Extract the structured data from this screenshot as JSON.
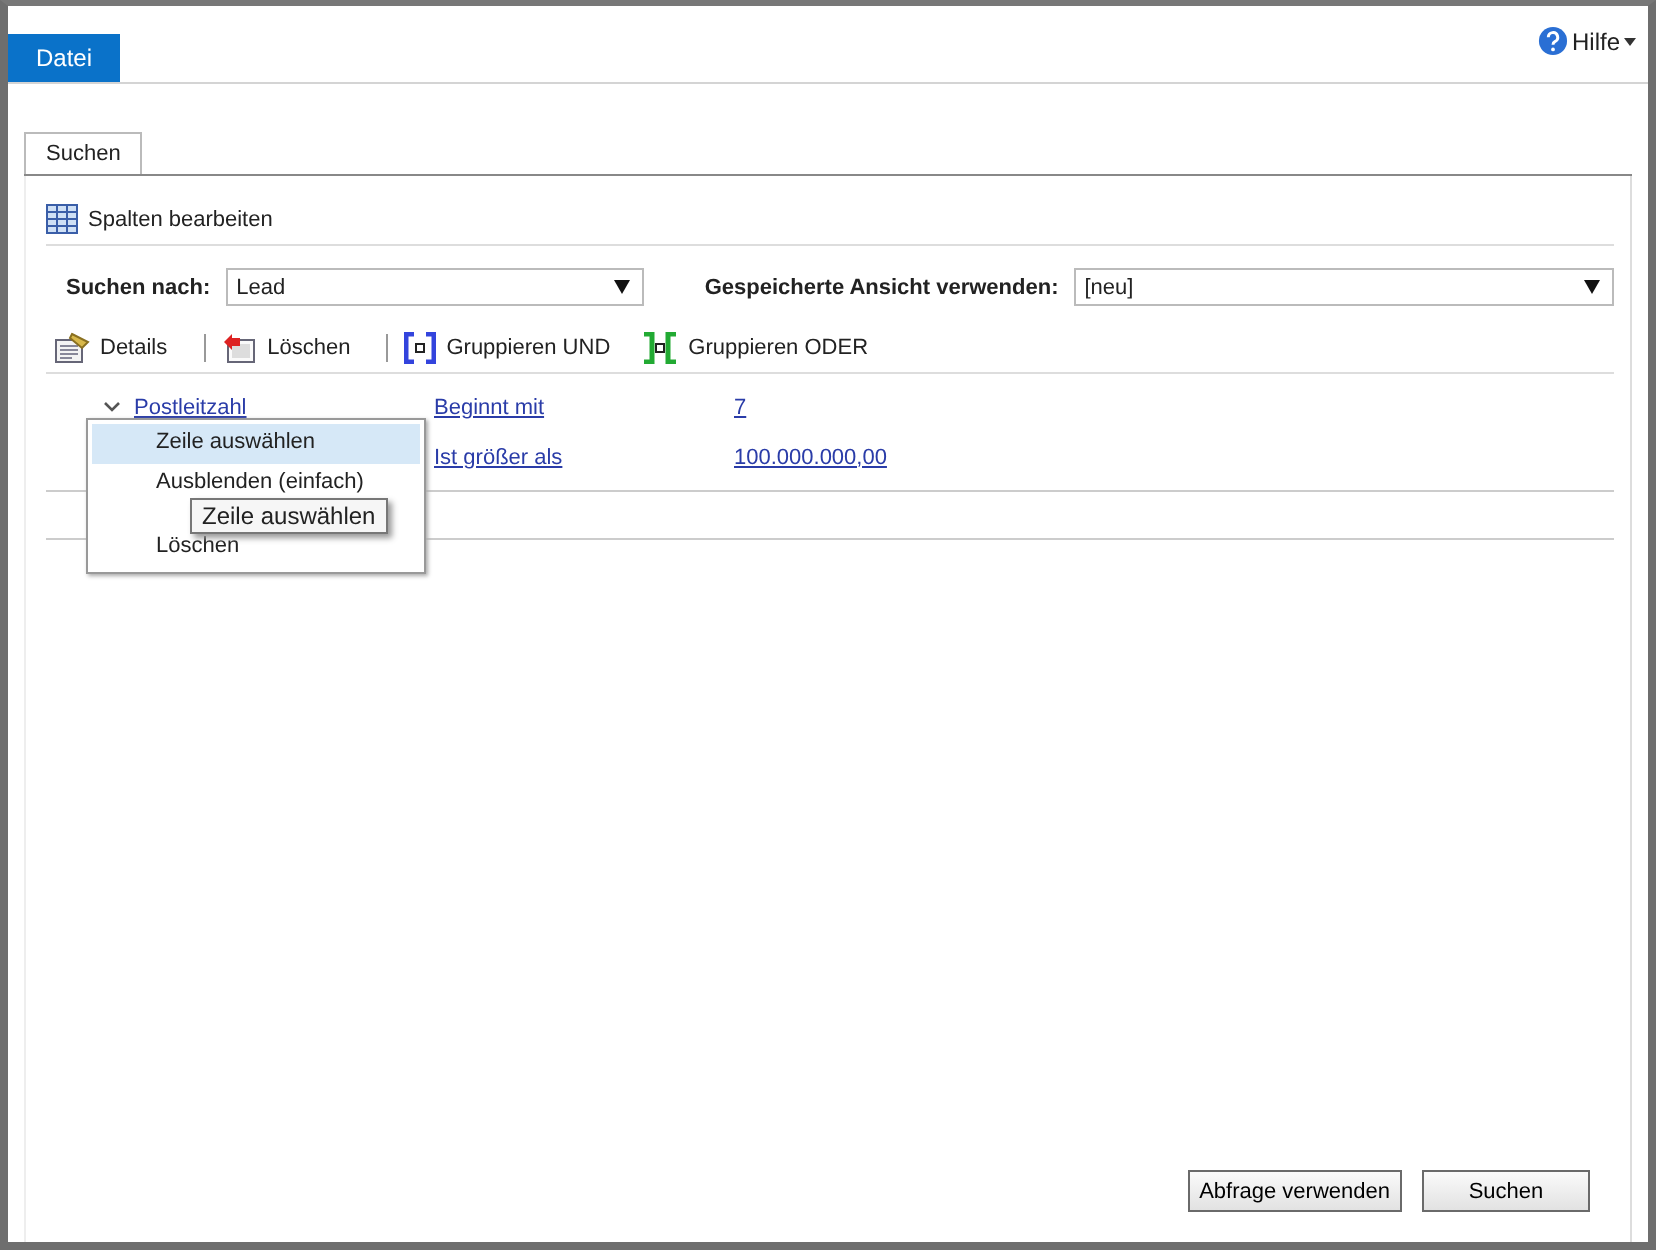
{
  "menu_tabs": [
    {
      "label": "Datei",
      "selected": true
    }
  ],
  "help": {
    "label": "Hilfe"
  },
  "tabs": [
    {
      "label": "Suchen",
      "selected": true
    }
  ],
  "edit_columns": {
    "label": "Spalten bearbeiten"
  },
  "search_for": {
    "label": "Suchen nach:",
    "value": "Lead"
  },
  "saved_view": {
    "label": "Gespeicherte Ansicht verwenden:",
    "value": "[neu]"
  },
  "toolbar": [
    {
      "kind": "details",
      "label": "Details"
    },
    {
      "kind": "delete",
      "label": "Löschen"
    },
    {
      "kind": "and",
      "label": "Gruppieren UND"
    },
    {
      "kind": "or",
      "label": "Gruppieren ODER"
    }
  ],
  "rows": [
    {
      "field": "Postleitzahl",
      "operator": "Beginnt mit",
      "value": "7",
      "expanded": true
    },
    {
      "operator": "Ist größer als",
      "value": "100.000.000,00"
    }
  ],
  "context_menu": [
    {
      "label": "Zeile auswählen",
      "selected": true
    },
    {
      "label": "Ausblenden (einfach)",
      "selected": false
    },
    {
      "label": "Löschen",
      "selected": false
    }
  ],
  "tooltip": "Zeile auswählen",
  "buttons": [
    "Abfrage verwenden",
    "Suchen"
  ]
}
